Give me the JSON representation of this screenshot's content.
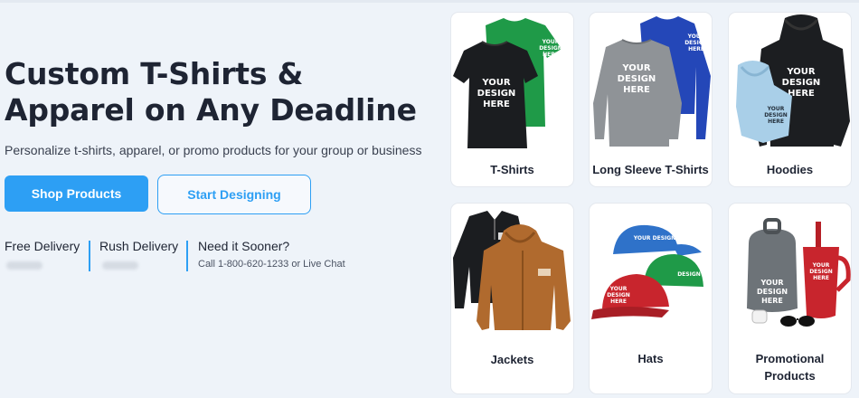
{
  "hero": {
    "title_line1": "Custom T-Shirts &",
    "title_line2": "Apparel on Any Deadline",
    "subtitle": "Personalize t-shirts, apparel, or promo products for your group or business"
  },
  "buttons": {
    "shop": "Shop Products",
    "design": "Start Designing"
  },
  "delivery": {
    "free": "Free Delivery",
    "rush": "Rush Delivery",
    "sooner": "Need it Sooner?",
    "sooner_detail": "Call 1-800-620-1233 or Live Chat"
  },
  "mockup_text": "YOUR DESIGN HERE",
  "categories": [
    {
      "label": "T-Shirts",
      "icon": "tshirt-icon"
    },
    {
      "label": "Long Sleeve T-Shirts",
      "icon": "long-sleeve-icon"
    },
    {
      "label": "Hoodies",
      "icon": "hoodie-icon"
    },
    {
      "label": "Jackets",
      "icon": "jacket-icon"
    },
    {
      "label": "Hats",
      "icon": "hat-icon"
    },
    {
      "label_line1": "Promotional",
      "label_line2": "Products",
      "icon": "promo-icon"
    }
  ],
  "colors": {
    "accent": "#2d9ff4",
    "background": "#eef3f9",
    "text": "#1e2433",
    "green": "#1f9a48",
    "blue": "#2447b8",
    "red": "#c8252d",
    "brown": "#b06a2e"
  }
}
